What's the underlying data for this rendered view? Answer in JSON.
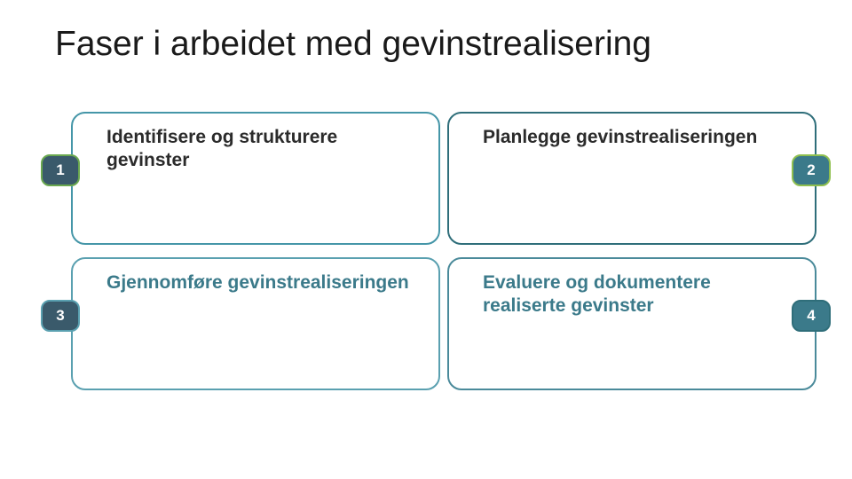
{
  "title": "Faser i arbeidet med gevinstrealisering",
  "cards": [
    {
      "num": "1",
      "label": "Identifisere og strukturere gevinster"
    },
    {
      "num": "2",
      "label": "Planlegge gevinstrealiseringen"
    },
    {
      "num": "3",
      "label": "Gjennomføre gevinstrealiseringen"
    },
    {
      "num": "4",
      "label": "Evaluere og dokumentere realiserte gevinster"
    }
  ]
}
